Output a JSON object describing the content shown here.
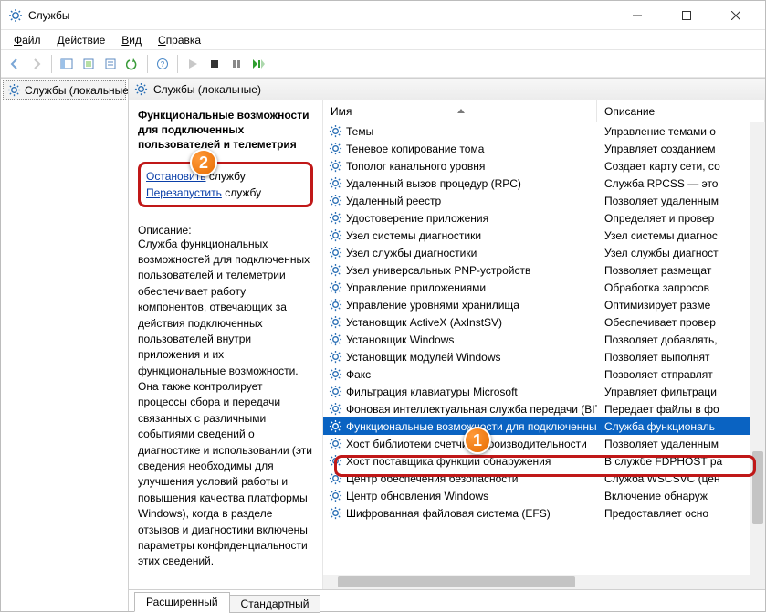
{
  "window": {
    "title": "Службы"
  },
  "menu": {
    "file": "Файл",
    "action": "Действие",
    "view": "Вид",
    "help": "Справка"
  },
  "tree": {
    "root": "Службы (локальные)"
  },
  "pane": {
    "header": "Службы (локальные)"
  },
  "detail": {
    "name": "Функциональные возможности для подключенных пользователей и телеметрия",
    "stop_link": "Остановить",
    "stop_suffix": " службу",
    "restart_link": "Перезапустить",
    "restart_suffix": " службу",
    "desc_label": "Описание:",
    "desc_text": "Служба функциональных возможностей для подключенных пользователей и телеметрии обеспечивает работу компонентов, отвечающих за действия подключенных пользователей внутри приложения и их функциональные возможности. Она также контролирует процессы сбора и передачи связанных с различными событиями сведений о диагностике и использовании (эти сведения необходимы для улучшения условий работы и повышения качества платформы Windows), когда в разделе отзывов и диагностики включены параметры конфиденциальности этих сведений."
  },
  "columns": {
    "name": "Имя",
    "desc": "Описание"
  },
  "services": [
    {
      "name": "Темы",
      "desc": "Управление темами о"
    },
    {
      "name": "Теневое копирование тома",
      "desc": "Управляет созданием"
    },
    {
      "name": "Тополог канального уровня",
      "desc": "Создает карту сети, со"
    },
    {
      "name": "Удаленный вызов процедур (RPC)",
      "desc": "Служба RPCSS — это"
    },
    {
      "name": "Удаленный реестр",
      "desc": "Позволяет удаленным"
    },
    {
      "name": "Удостоверение приложения",
      "desc": "Определяет и провер"
    },
    {
      "name": "Узел системы диагностики",
      "desc": "Узел системы диагнос"
    },
    {
      "name": "Узел службы диагностики",
      "desc": "Узел службы диагност"
    },
    {
      "name": "Узел универсальных PNP-устройств",
      "desc": "Позволяет размещат"
    },
    {
      "name": "Управление приложениями",
      "desc": "Обработка запросов"
    },
    {
      "name": "Управление уровнями хранилища",
      "desc": "Оптимизирует разме"
    },
    {
      "name": "Установщик ActiveX (AxInstSV)",
      "desc": "Обеспечивает провер"
    },
    {
      "name": "Установщик Windows",
      "desc": "Позволяет добавлять,"
    },
    {
      "name": "Установщик модулей Windows",
      "desc": "Позволяет выполнят"
    },
    {
      "name": "Факс",
      "desc": "Позволяет отправлят"
    },
    {
      "name": "Фильтрация клавиатуры Microsoft",
      "desc": "Управляет фильтраци"
    },
    {
      "name": "Фоновая интеллектуальная служба передачи (BITS)",
      "desc": "Передает файлы в фо"
    },
    {
      "name": "Функциональные возможности для подключенных ...",
      "desc": "Служба функциональ",
      "selected": true
    },
    {
      "name": "Хост библиотеки счетчика производительности",
      "desc": "Позволяет удаленным"
    },
    {
      "name": "Хост поставщика функции обнаружения",
      "desc": "В службе FDPHOST ра"
    },
    {
      "name": "Центр обеспечения безопасности",
      "desc": "Служба WSCSVC (цен"
    },
    {
      "name": "Центр обновления Windows",
      "desc": "Включение обнаруж"
    },
    {
      "name": "Шифрованная файловая система (EFS)",
      "desc": "Предоставляет осно"
    }
  ],
  "tabs": {
    "extended": "Расширенный",
    "standard": "Стандартный"
  },
  "chart_data": null
}
